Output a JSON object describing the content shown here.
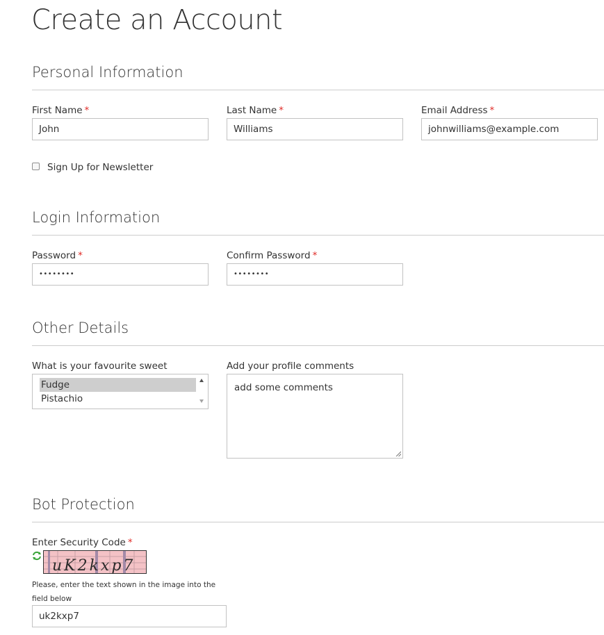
{
  "page": {
    "title": "Create an Account"
  },
  "personal": {
    "heading": "Personal Information",
    "first_name": {
      "label": "First Name",
      "value": "John",
      "required": "*"
    },
    "last_name": {
      "label": "Last Name",
      "value": "Williams",
      "required": "*"
    },
    "email": {
      "label": "Email Address",
      "value": "johnwilliams@example.com",
      "required": "*"
    },
    "newsletter": {
      "label": "Sign Up for Newsletter",
      "checked": false
    }
  },
  "login": {
    "heading": "Login Information",
    "password": {
      "label": "Password",
      "value": "••••••••",
      "required": "*"
    },
    "confirm_password": {
      "label": "Confirm Password",
      "value": "••••••••",
      "required": "*"
    }
  },
  "other": {
    "heading": "Other Details",
    "sweet": {
      "label": "What is your favourite sweet",
      "options": [
        "Fudge",
        "Pistachio"
      ],
      "selected": "Fudge"
    },
    "comments": {
      "label": "Add your profile comments",
      "value": "add some comments"
    }
  },
  "bot": {
    "heading": "Bot Protection",
    "code_label": "Enter Security Code",
    "required": "*",
    "captcha_text": "uK2kxp7",
    "hint": "Please, enter the text shown in the image into the field below",
    "code_value": "uk2kxp7"
  },
  "colors": {
    "required": "#e02b27",
    "rule": "#cccccc",
    "border": "#c2c2c2",
    "captcha_bg": "#f4c2c6",
    "refresh_icon": "#3aa53a"
  },
  "icons": {
    "refresh": "refresh-icon",
    "resize": "resize-grip-icon",
    "scroll_up": "chevron-up-icon",
    "scroll_down": "chevron-down-icon"
  }
}
